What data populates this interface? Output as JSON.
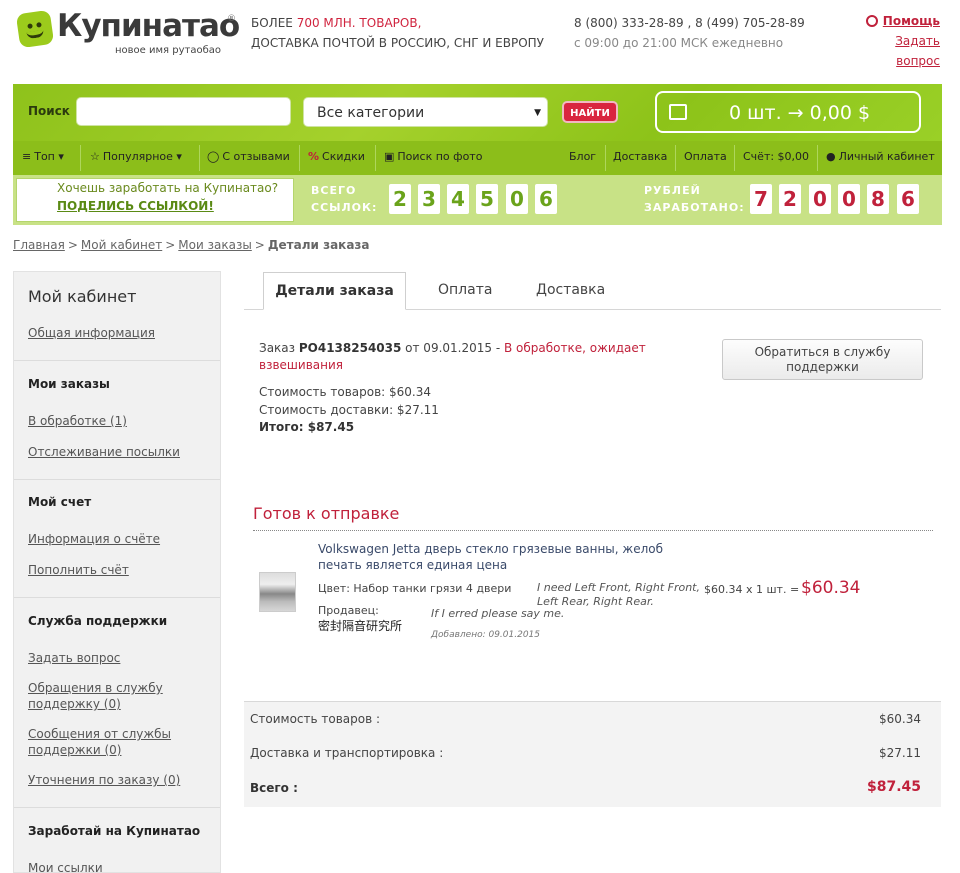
{
  "header": {
    "brand": "Купинатао",
    "brand_reg": "®",
    "brand_sub": "новое имя рутаобао",
    "tagline_prefix": "БОЛЕЕ ",
    "tagline_highlight": "700 МЛН. ТОВАРОВ,",
    "tagline_line2": "ДОСТАВКА ПОЧТОЙ В РОССИЮ, СНГ И ЕВРОПУ",
    "phones": "8 (800) 333-28-89 , 8 (499) 705-28-89",
    "hours": "с 09:00 до 21:00 МСК ежедневно",
    "help": "Помощь",
    "ask": "Задать вопрос"
  },
  "search": {
    "label": "Поиск",
    "placeholder": "",
    "category": "Все категории",
    "button": "НАЙТИ"
  },
  "cart": {
    "summary": "0 шт. → 0,00 $"
  },
  "nav": {
    "top": "Топ",
    "popular": "Популярное",
    "reviews": "С отзывами",
    "discounts": "Скидки",
    "photo_search": "Поиск по фото",
    "blog": "Блог",
    "delivery": "Доставка",
    "payment": "Оплата",
    "account_balance": "Счёт: $0,00",
    "cabinet": "Личный кабинет"
  },
  "referral": {
    "question": "Хочешь заработать на Купинатао?",
    "link": "ПОДЕЛИСЬ ССЫЛКОЙ!",
    "links_label_1": "ВСЕГО",
    "links_label_2": "ССЫЛОК:",
    "links_digits": [
      "2",
      "3",
      "4",
      "5",
      "0",
      "6"
    ],
    "earned_label_1": "РУБЛЕЙ",
    "earned_label_2": "ЗАРАБОТАНО:",
    "earned_digits": [
      "7",
      "2",
      "0",
      "0",
      "8",
      "6"
    ]
  },
  "breadcrumb": {
    "home": "Главная",
    "cabinet": "Мой кабинет",
    "orders": "Мои заказы",
    "current": "Детали заказа",
    "sep": ">"
  },
  "sidebar": {
    "title": "Мой кабинет",
    "general": "Общая информация",
    "orders_h": "Мои заказы",
    "in_process": "В обработке (1)",
    "tracking": "Отслеживание посылки",
    "account_h": "Мой счет",
    "account_info": "Информация о счёте",
    "top_up": "Пополнить счёт",
    "support_h": "Служба поддержки",
    "ask": "Задать вопрос",
    "appeals_1": "Обращения в службу",
    "appeals_2": "поддержку (0)",
    "messages_1": "Сообщения от службы",
    "messages_2": "поддержки (0)",
    "clarifications": "Уточнения по заказу (0)",
    "earn_h": "Заработай на Купинатао",
    "my_links": "Мои ссылки"
  },
  "tabs": {
    "details": "Детали заказа",
    "payment": "Оплата",
    "delivery": "Доставка"
  },
  "order": {
    "prefix": "Заказ ",
    "number": "PO4138254035",
    "date_text": " от 09.01.2015 - ",
    "status": "В обработке, ожидает взвешивания",
    "goods_cost": "Стоимость товаров: $60.34",
    "delivery_cost": "Стоимость доставки: $27.11",
    "total": "Итого: $87.45",
    "support_button_1": "Обратиться в службу",
    "support_button_2": "поддержки"
  },
  "section": {
    "ready": "Готов к отправке"
  },
  "product": {
    "title": "Volkswagen Jetta дверь стекло грязевые ванны, желоб печать является единая цена",
    "color": "Цвет: Набор танки грязи 4 двери",
    "note": "I need Left Front, Right Front, Left Rear, Right Rear.",
    "calc": "$60.34 x 1 шт. =",
    "price": "$60.34",
    "seller_label": "Продавец:",
    "seller_name": "密封隔音研究所",
    "seller_note": "If I erred please say me.",
    "added": "Добавлено: 09.01.2015"
  },
  "summary": {
    "goods_label": "Стоимость товаров :",
    "goods_value": "$60.34",
    "shipping_label": "Доставка и транспортировка :",
    "shipping_value": "$27.11",
    "total_label": "Всего :",
    "total_value": "$87.45"
  }
}
